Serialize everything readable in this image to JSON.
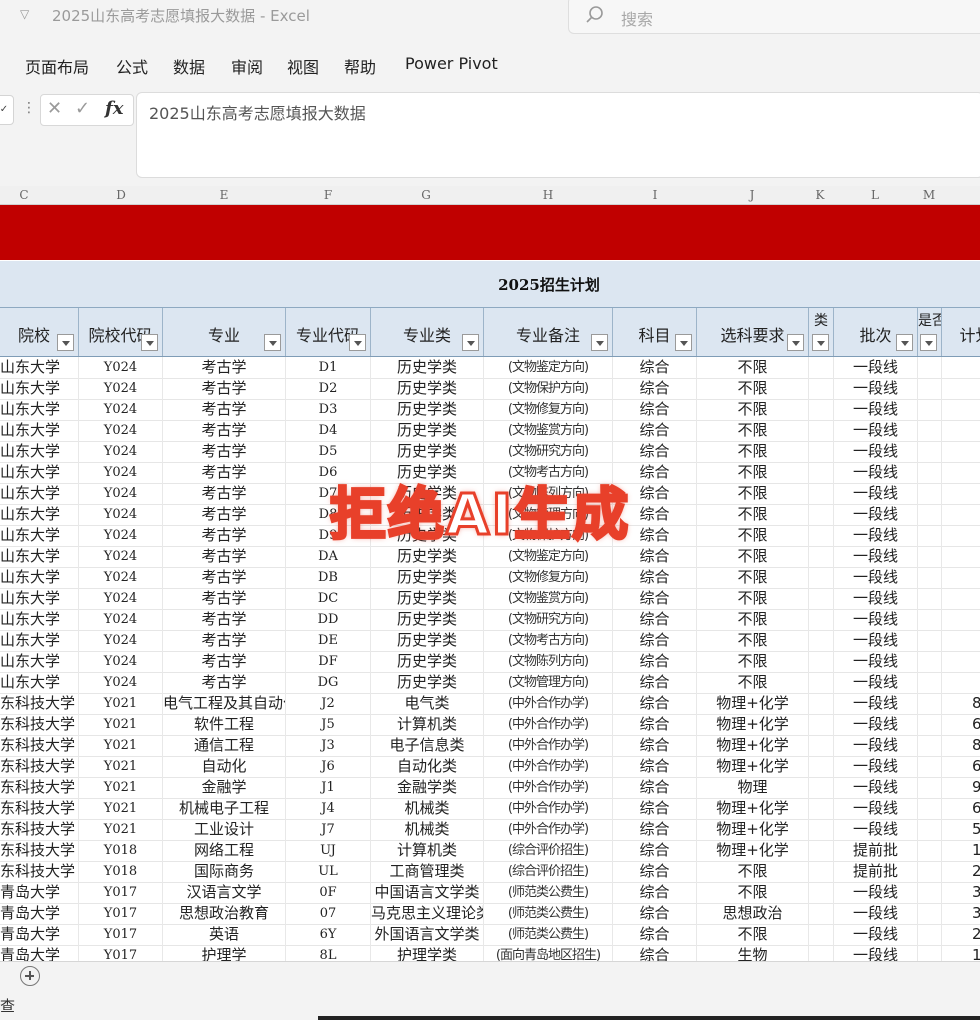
{
  "window": {
    "title": "2025山东高考志愿填报大数据  -  Excel",
    "search_placeholder": "搜索"
  },
  "ribbon_tabs": [
    "页面布局",
    "公式",
    "数据",
    "审阅",
    "视图",
    "帮助",
    "Power Pivot"
  ],
  "formula_bar": {
    "content": "2025山东高考志愿填报大数据",
    "fx": "fx"
  },
  "column_letters": [
    "C",
    "D",
    "E",
    "F",
    "G",
    "H",
    "I",
    "J",
    "K",
    "L",
    "M"
  ],
  "plan_title": "2025招生计划",
  "headers": [
    "院校",
    "院校代码",
    "专业",
    "专业代码",
    "专业类",
    "专业备注",
    "科目",
    "选科要求",
    "类",
    "批次",
    "是否",
    "计划"
  ],
  "rows": [
    [
      "山东大学",
      "Y024",
      "考古学",
      "D1",
      "历史学类",
      "(文物鉴定方向)",
      "综合",
      "不限",
      "",
      "一段线",
      "",
      ""
    ],
    [
      "山东大学",
      "Y024",
      "考古学",
      "D2",
      "历史学类",
      "(文物保护方向)",
      "综合",
      "不限",
      "",
      "一段线",
      "",
      ""
    ],
    [
      "山东大学",
      "Y024",
      "考古学",
      "D3",
      "历史学类",
      "(文物修复方向)",
      "综合",
      "不限",
      "",
      "一段线",
      "",
      ""
    ],
    [
      "山东大学",
      "Y024",
      "考古学",
      "D4",
      "历史学类",
      "(文物鉴赏方向)",
      "综合",
      "不限",
      "",
      "一段线",
      "",
      ""
    ],
    [
      "山东大学",
      "Y024",
      "考古学",
      "D5",
      "历史学类",
      "(文物研究方向)",
      "综合",
      "不限",
      "",
      "一段线",
      "",
      ""
    ],
    [
      "山东大学",
      "Y024",
      "考古学",
      "D6",
      "历史学类",
      "(文物考古方向)",
      "综合",
      "不限",
      "",
      "一段线",
      "",
      ""
    ],
    [
      "山东大学",
      "Y024",
      "考古学",
      "D7",
      "历史学类",
      "(文物陈列方向)",
      "综合",
      "不限",
      "",
      "一段线",
      "",
      ""
    ],
    [
      "山东大学",
      "Y024",
      "考古学",
      "D8",
      "历史学类",
      "(文物管理方向)",
      "综合",
      "不限",
      "",
      "一段线",
      "",
      ""
    ],
    [
      "山东大学",
      "Y024",
      "考古学",
      "D9",
      "历史学类",
      "(文物保护方向)",
      "综合",
      "不限",
      "",
      "一段线",
      "",
      ""
    ],
    [
      "山东大学",
      "Y024",
      "考古学",
      "DA",
      "历史学类",
      "(文物鉴定方向)",
      "综合",
      "不限",
      "",
      "一段线",
      "",
      ""
    ],
    [
      "山东大学",
      "Y024",
      "考古学",
      "DB",
      "历史学类",
      "(文物修复方向)",
      "综合",
      "不限",
      "",
      "一段线",
      "",
      ""
    ],
    [
      "山东大学",
      "Y024",
      "考古学",
      "DC",
      "历史学类",
      "(文物鉴赏方向)",
      "综合",
      "不限",
      "",
      "一段线",
      "",
      ""
    ],
    [
      "山东大学",
      "Y024",
      "考古学",
      "DD",
      "历史学类",
      "(文物研究方向)",
      "综合",
      "不限",
      "",
      "一段线",
      "",
      ""
    ],
    [
      "山东大学",
      "Y024",
      "考古学",
      "DE",
      "历史学类",
      "(文物考古方向)",
      "综合",
      "不限",
      "",
      "一段线",
      "",
      ""
    ],
    [
      "山东大学",
      "Y024",
      "考古学",
      "DF",
      "历史学类",
      "(文物陈列方向)",
      "综合",
      "不限",
      "",
      "一段线",
      "",
      ""
    ],
    [
      "山东大学",
      "Y024",
      "考古学",
      "DG",
      "历史学类",
      "(文物管理方向)",
      "综合",
      "不限",
      "",
      "一段线",
      "",
      ""
    ],
    [
      "东科技大学",
      "Y021",
      "电气工程及其自动化",
      "J2",
      "电气类",
      "(中外合作办学)",
      "综合",
      "物理+化学",
      "",
      "一段线",
      "",
      "8"
    ],
    [
      "东科技大学",
      "Y021",
      "软件工程",
      "J5",
      "计算机类",
      "(中外合作办学)",
      "综合",
      "物理+化学",
      "",
      "一段线",
      "",
      "6"
    ],
    [
      "东科技大学",
      "Y021",
      "通信工程",
      "J3",
      "电子信息类",
      "(中外合作办学)",
      "综合",
      "物理+化学",
      "",
      "一段线",
      "",
      "8"
    ],
    [
      "东科技大学",
      "Y021",
      "自动化",
      "J6",
      "自动化类",
      "(中外合作办学)",
      "综合",
      "物理+化学",
      "",
      "一段线",
      "",
      "6"
    ],
    [
      "东科技大学",
      "Y021",
      "金融学",
      "J1",
      "金融学类",
      "(中外合作办学)",
      "综合",
      "物理",
      "",
      "一段线",
      "",
      "9"
    ],
    [
      "东科技大学",
      "Y021",
      "机械电子工程",
      "J4",
      "机械类",
      "(中外合作办学)",
      "综合",
      "物理+化学",
      "",
      "一段线",
      "",
      "6"
    ],
    [
      "东科技大学",
      "Y021",
      "工业设计",
      "J7",
      "机械类",
      "(中外合作办学)",
      "综合",
      "物理+化学",
      "",
      "一段线",
      "",
      "5"
    ],
    [
      "东科技大学",
      "Y018",
      "网络工程",
      "UJ",
      "计算机类",
      "(综合评价招生)",
      "综合",
      "物理+化学",
      "",
      "提前批",
      "",
      "1"
    ],
    [
      "东科技大学",
      "Y018",
      "国际商务",
      "UL",
      "工商管理类",
      "(综合评价招生)",
      "综合",
      "不限",
      "",
      "提前批",
      "",
      "2"
    ],
    [
      "青岛大学",
      "Y017",
      "汉语言文学",
      "0F",
      "中国语言文学类",
      "(师范类公费生)",
      "综合",
      "不限",
      "",
      "一段线",
      "",
      "3"
    ],
    [
      "青岛大学",
      "Y017",
      "思想政治教育",
      "07",
      "马克思主义理论类",
      "(师范类公费生)",
      "综合",
      "思想政治",
      "",
      "一段线",
      "",
      "3"
    ],
    [
      "青岛大学",
      "Y017",
      "英语",
      "6Y",
      "外国语言文学类",
      "(师范类公费生)",
      "综合",
      "不限",
      "",
      "一段线",
      "",
      "2"
    ],
    [
      "青岛大学",
      "Y017",
      "护理学",
      "8L",
      "护理学类",
      "(面向青岛地区招生)",
      "综合",
      "生物",
      "",
      "一段线",
      "",
      "1"
    ]
  ],
  "watermark": "拒绝AI生成",
  "status": {
    "text": "查"
  },
  "colors": {
    "red_band": "#c00000",
    "header_bg": "#dce6f1",
    "watermark_stroke": "#e8402a"
  }
}
